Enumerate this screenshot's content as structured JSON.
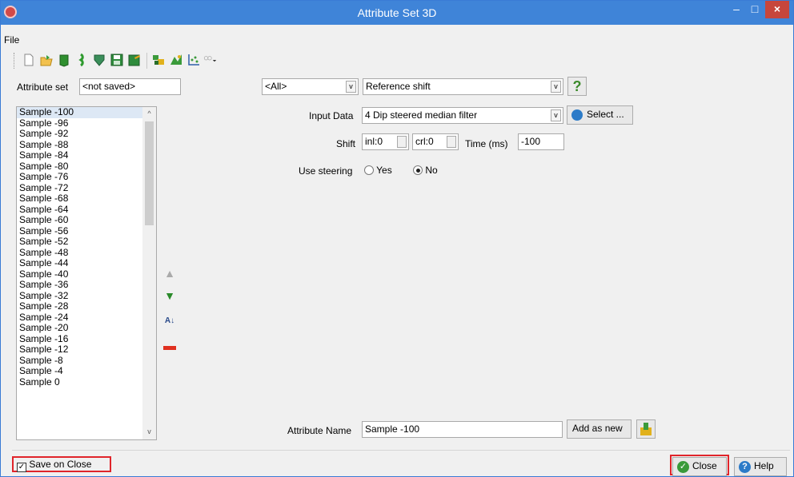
{
  "window": {
    "title": "Attribute Set 3D",
    "minimize_glyph": "–",
    "maximize_glyph": "□",
    "close_glyph": "×"
  },
  "menu": {
    "file": "File"
  },
  "toolbar": {
    "icons": [
      "new-icon",
      "open-icon",
      "import-icon",
      "import-green-icon",
      "export-icon",
      "save-icon",
      "save-as-icon",
      "attribute-evaluate-icon",
      "cross-plot-icon",
      "crossplot-icon",
      "more-dropdown-icon"
    ]
  },
  "attribute_set": {
    "label": "Attribute set",
    "value": "<not saved>"
  },
  "filter": {
    "category": "<All>",
    "attribute_type": "Reference shift",
    "help_glyph": "?"
  },
  "attributes_list": [
    "Sample -100",
    "Sample -96",
    "Sample -92",
    "Sample -88",
    "Sample -84",
    "Sample -80",
    "Sample -76",
    "Sample -72",
    "Sample -68",
    "Sample -64",
    "Sample -60",
    "Sample -56",
    "Sample -52",
    "Sample -48",
    "Sample -44",
    "Sample -40",
    "Sample -36",
    "Sample -32",
    "Sample -28",
    "Sample -24",
    "Sample -20",
    "Sample -16",
    "Sample -12",
    "Sample -8",
    "Sample -4",
    "Sample 0"
  ],
  "list_selected_index": 0,
  "input_data": {
    "label": "Input Data",
    "value": "4 Dip steered median filter",
    "select_button": "Select ..."
  },
  "shift": {
    "label": "Shift",
    "inl": "inl:0",
    "crl": "crl:0",
    "time_label": "Time (ms)",
    "time_value": "-100"
  },
  "steering": {
    "label": "Use steering",
    "yes": "Yes",
    "no": "No",
    "selected": "No"
  },
  "attribute_name": {
    "label": "Attribute Name",
    "value": "Sample -100",
    "add_button": "Add as new"
  },
  "footer": {
    "save_on_close": "Save on Close",
    "save_on_close_checked": true,
    "close_button": "Close",
    "help_button": "Help"
  },
  "colors": {
    "titlebar": "#3f84d8",
    "highlight_box": "#e0242a",
    "close_red": "#c7463c"
  }
}
